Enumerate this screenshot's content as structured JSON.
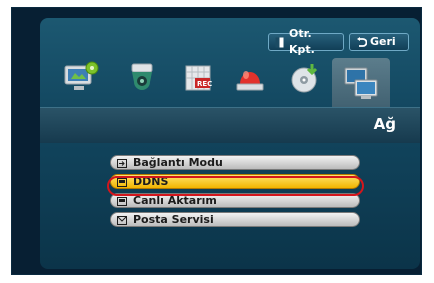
{
  "top_buttons": {
    "exit_label": "Otr. Kpt.",
    "back_label": "Geri"
  },
  "tabs": [
    {
      "name": "settings-monitor",
      "icon": "monitor-gear-icon"
    },
    {
      "name": "camera",
      "icon": "dome-camera-icon"
    },
    {
      "name": "record",
      "icon": "calendar-rec-icon"
    },
    {
      "name": "alarm",
      "icon": "alarm-siren-icon"
    },
    {
      "name": "backup",
      "icon": "disc-backup-icon"
    },
    {
      "name": "network",
      "icon": "network-computers-icon"
    }
  ],
  "section_title": "Ağ",
  "menu": {
    "items": [
      {
        "label": "Bağlantı Modu",
        "icon": "connection-icon"
      },
      {
        "label": "DDNS",
        "icon": "ddns-icon"
      },
      {
        "label": "Canlı Aktarım",
        "icon": "stream-icon"
      },
      {
        "label": "Posta Servisi",
        "icon": "mail-icon"
      }
    ],
    "selected_label": "DDNS"
  },
  "colors": {
    "background": "#0b3449",
    "selection": "#f2b400",
    "selection_ring": "#d3161c"
  }
}
